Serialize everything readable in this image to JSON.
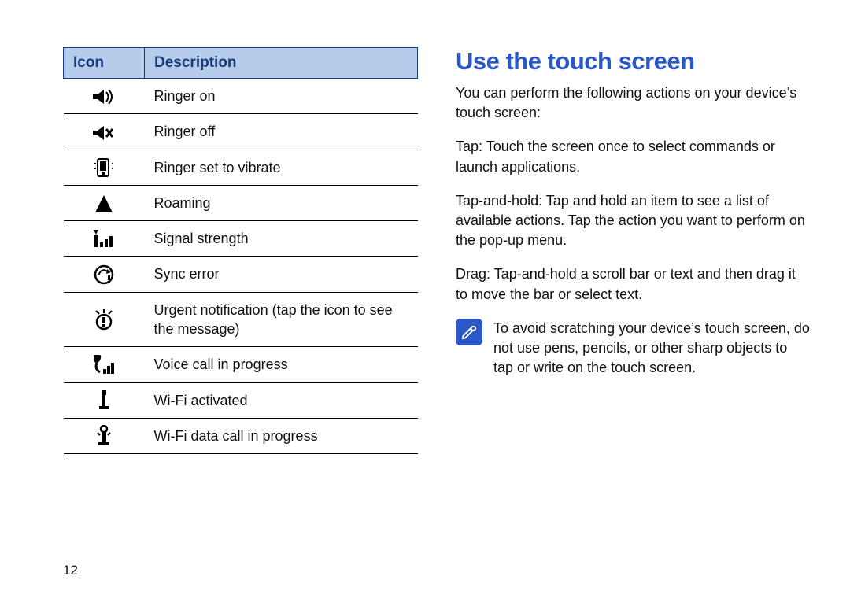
{
  "page_number": "12",
  "table": {
    "headers": {
      "icon": "Icon",
      "desc": "Description"
    },
    "rows": [
      {
        "icon": "ringer-on",
        "desc": "Ringer on"
      },
      {
        "icon": "ringer-off",
        "desc": "Ringer off"
      },
      {
        "icon": "vibrate",
        "desc": "Ringer set to vibrate"
      },
      {
        "icon": "roaming",
        "desc": "Roaming"
      },
      {
        "icon": "signal",
        "desc": "Signal strength"
      },
      {
        "icon": "sync-error",
        "desc": "Sync error"
      },
      {
        "icon": "urgent",
        "desc": "Urgent notification (tap the icon to see the message)"
      },
      {
        "icon": "voice-call",
        "desc": "Voice call in progress"
      },
      {
        "icon": "wifi-on",
        "desc": "Wi-Fi activated"
      },
      {
        "icon": "wifi-data",
        "desc": "Wi-Fi data call in progress"
      }
    ]
  },
  "right": {
    "heading": "Use the touch screen",
    "p1": "You can perform the following actions on your device’s touch screen:",
    "p2": "Tap: Touch the screen once to select commands or launch applications.",
    "p3": "Tap-and-hold: Tap and hold an item to see a list of available actions. Tap the action you want to perform on the pop-up menu.",
    "p4": "Drag: Tap-and-hold a scroll bar or text and then drag it to move the bar or select text.",
    "note": "To avoid scratching your device’s touch screen, do not use pens, pencils, or other sharp objects to tap or write on the touch screen."
  }
}
